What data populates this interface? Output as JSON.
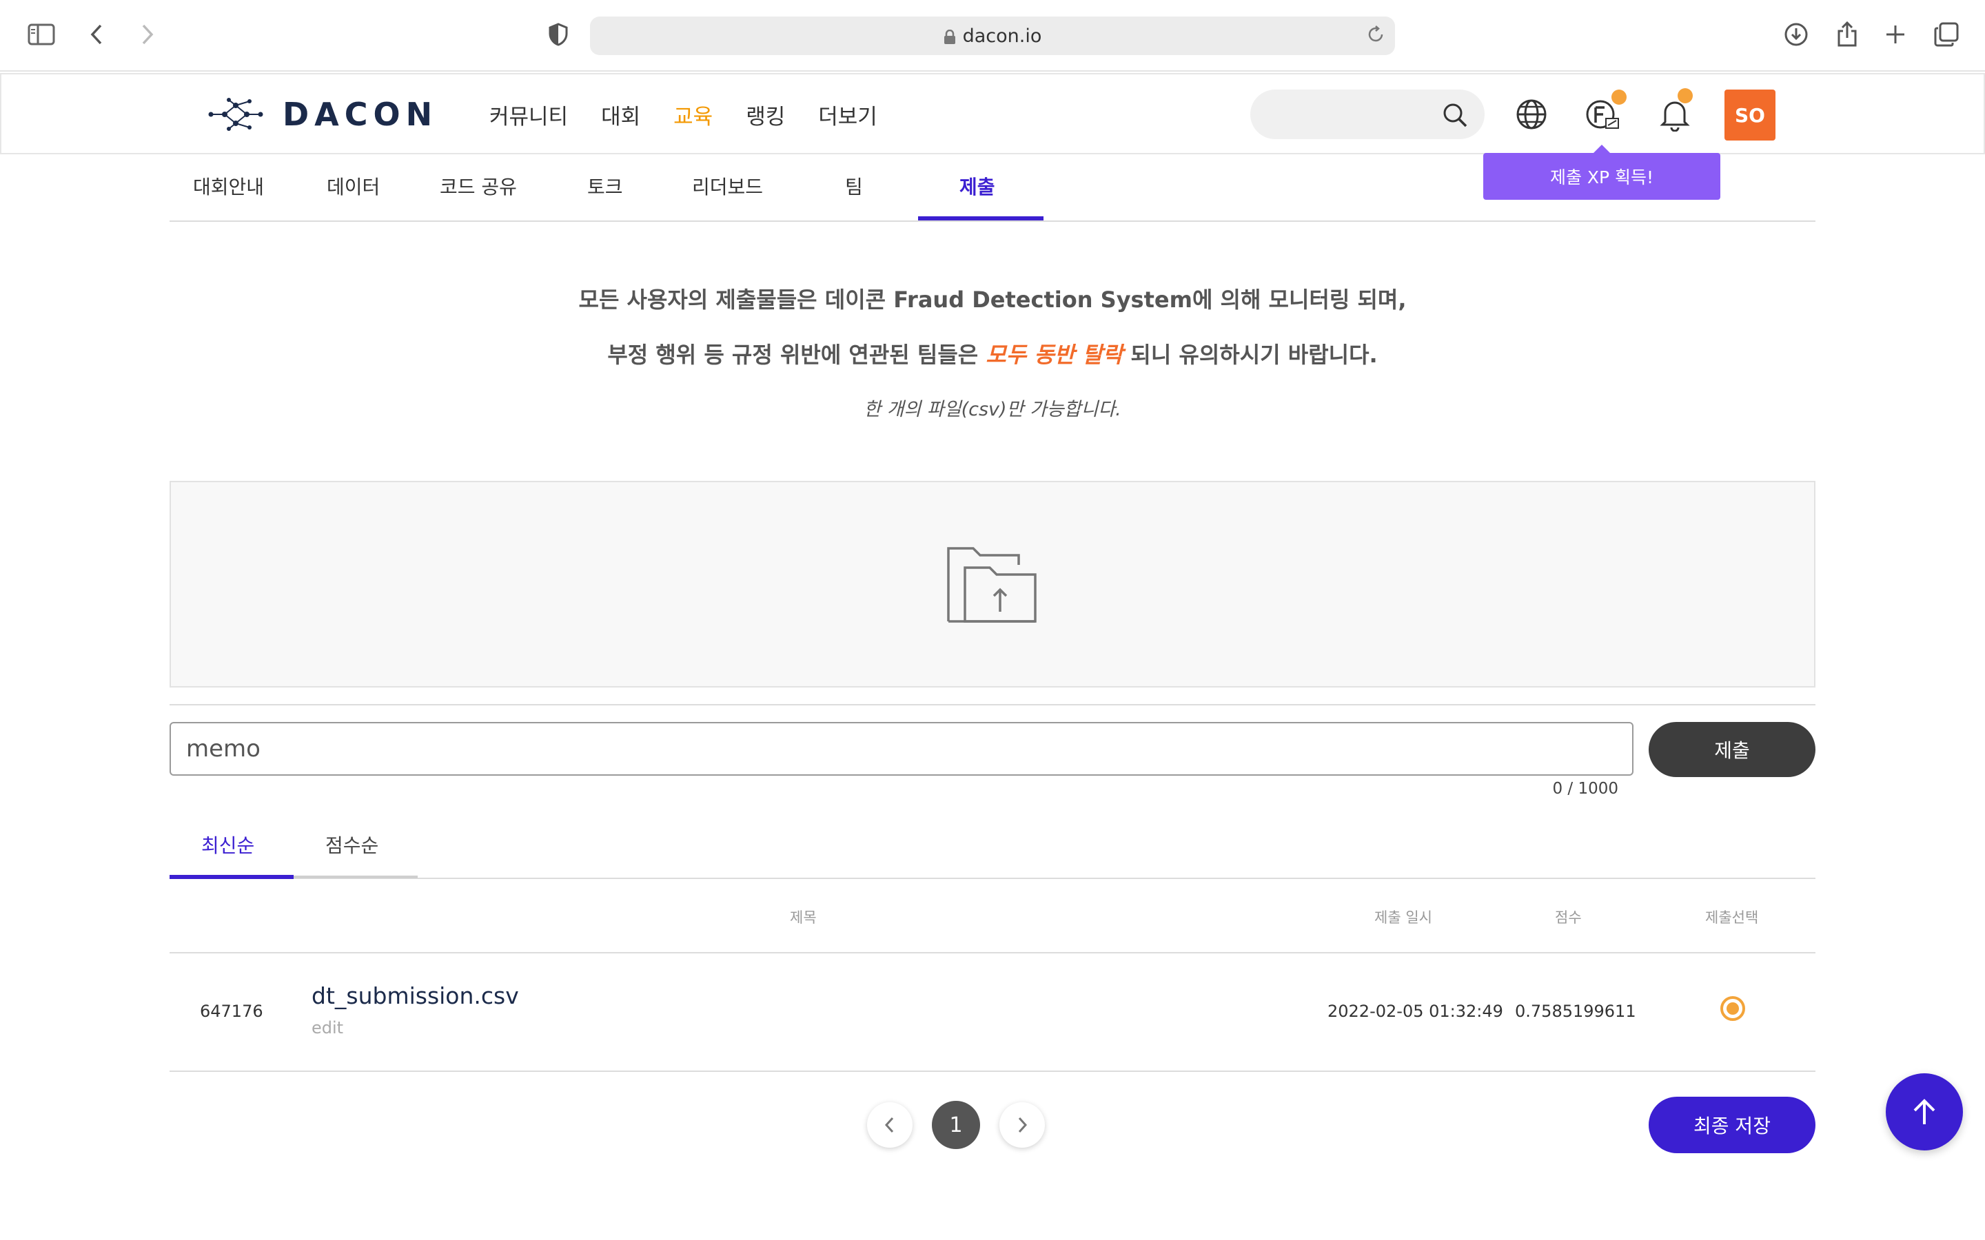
{
  "browser": {
    "url": "dacon.io"
  },
  "header": {
    "logo_text": "DACON",
    "nav": [
      "커뮤니티",
      "대회",
      "교육",
      "랭킹",
      "더보기"
    ],
    "active_nav": "교육",
    "search_placeholder": "",
    "avatar_initials": "SO",
    "tooltip": "제출 XP 획득!"
  },
  "sub_tabs": [
    "대회안내",
    "데이터",
    "코드 공유",
    "토크",
    "리더보드",
    "팀",
    "제출"
  ],
  "active_sub_tab": "제출",
  "notice": {
    "line1": "모든 사용자의 제출물들은 데이콘 Fraud Detection System에 의해 모니터링 되며,",
    "line2_before": "부정 행위 등 규정 위반에 연관된 팀들은 ",
    "line2_warn": "모두 동반 탈락",
    "line2_after": " 되니 유의하시기 바랍니다.",
    "sub": "한 개의 파일(csv)만 가능합니다."
  },
  "memo": {
    "placeholder": "memo",
    "value": "",
    "counter": "0 / 1000",
    "submit_label": "제출"
  },
  "sort_tabs": [
    "최신순",
    "점수순"
  ],
  "active_sort": "최신순",
  "table": {
    "headers": {
      "title": "제목",
      "date": "제출 일시",
      "score": "점수",
      "select": "제출선택"
    },
    "rows": [
      {
        "id": "647176",
        "filename": "dt_submission.csv",
        "edit": "edit",
        "date": "2022-02-05 01:32:49",
        "score": "0.7585199611",
        "selected": true
      }
    ]
  },
  "pagination": {
    "current": "1"
  },
  "final_save_label": "최종 저장",
  "colors": {
    "brand_purple": "#3b1fd1",
    "accent_orange": "#f39800",
    "warn_orange": "#f26b2a",
    "tooltip_purple": "#8b5cf6"
  }
}
